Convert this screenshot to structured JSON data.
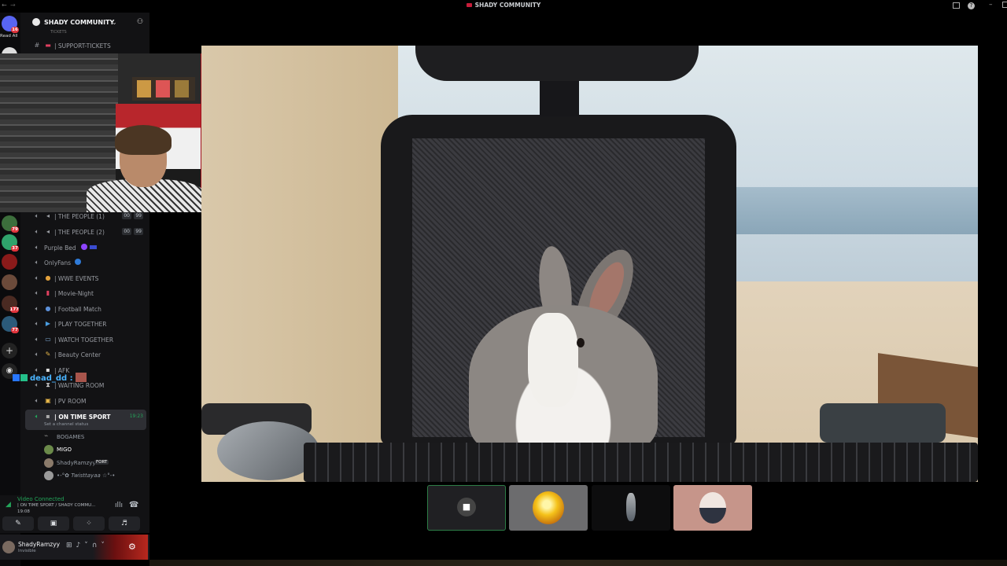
{
  "window": {
    "title": "SHADY COMMUNITY"
  },
  "rail": {
    "read_all": "Read All",
    "dm_badge": "16",
    "badges": [
      "79",
      "37",
      "177",
      "77"
    ]
  },
  "server": {
    "name": "SHADY COMMUNITY",
    "chevron": "⌄"
  },
  "channels": {
    "tickets_label": "TICKETS",
    "support": "| SUPPORT-TICKETS",
    "people1": "| THE PEOPLE (1)",
    "people1_count_a": "00",
    "people1_count_b": "99",
    "people2": "| THE PEOPLE (2)",
    "people2_count_a": "00",
    "people2_count_b": "99",
    "purple_bed": "Purple Bed",
    "onlyfans": "OnlyFans",
    "wwe": "| WWE EVENTS",
    "movie": "| Movie-Night",
    "football": "| Football Match",
    "play": "| PLAY TOGETHER",
    "watch": "| WATCH TOGETHER",
    "beauty": "| Beauty Center",
    "afk": "| AFK",
    "waiting": "| WAITING ROOM",
    "pv": "| PV ROOM",
    "ontime": "| ON TIME SPORT",
    "ontime_time": "19:23",
    "ontime_status": "Set a channel status"
  },
  "members": [
    {
      "name": "BOGAMES"
    },
    {
      "name": "MIGO"
    },
    {
      "name": "ShadyRamzyy",
      "tag": "FORT"
    },
    {
      "name": "•-°✿ Twisttayaa ☆°-•"
    }
  ],
  "chat": {
    "user": "dead_dd :"
  },
  "voice": {
    "status": "Video Connected",
    "location": "| ON TIME SPORT / SHADY COMMU...",
    "time": "19:08"
  },
  "user": {
    "name": "ShadyRamzyy",
    "status": "Invisible"
  },
  "icons": [
    "discord-icon",
    "hash-icon",
    "speaker-icon",
    "camera-icon",
    "screen-share-icon",
    "activity-icon",
    "soundboard-icon",
    "mic-icon",
    "headphones-icon",
    "gear-icon",
    "disconnect-icon",
    "signal-icon"
  ],
  "colors": {
    "accent_green": "#23a55a",
    "badge_red": "#e0343c",
    "chat_blue": "#4ab4ff"
  }
}
